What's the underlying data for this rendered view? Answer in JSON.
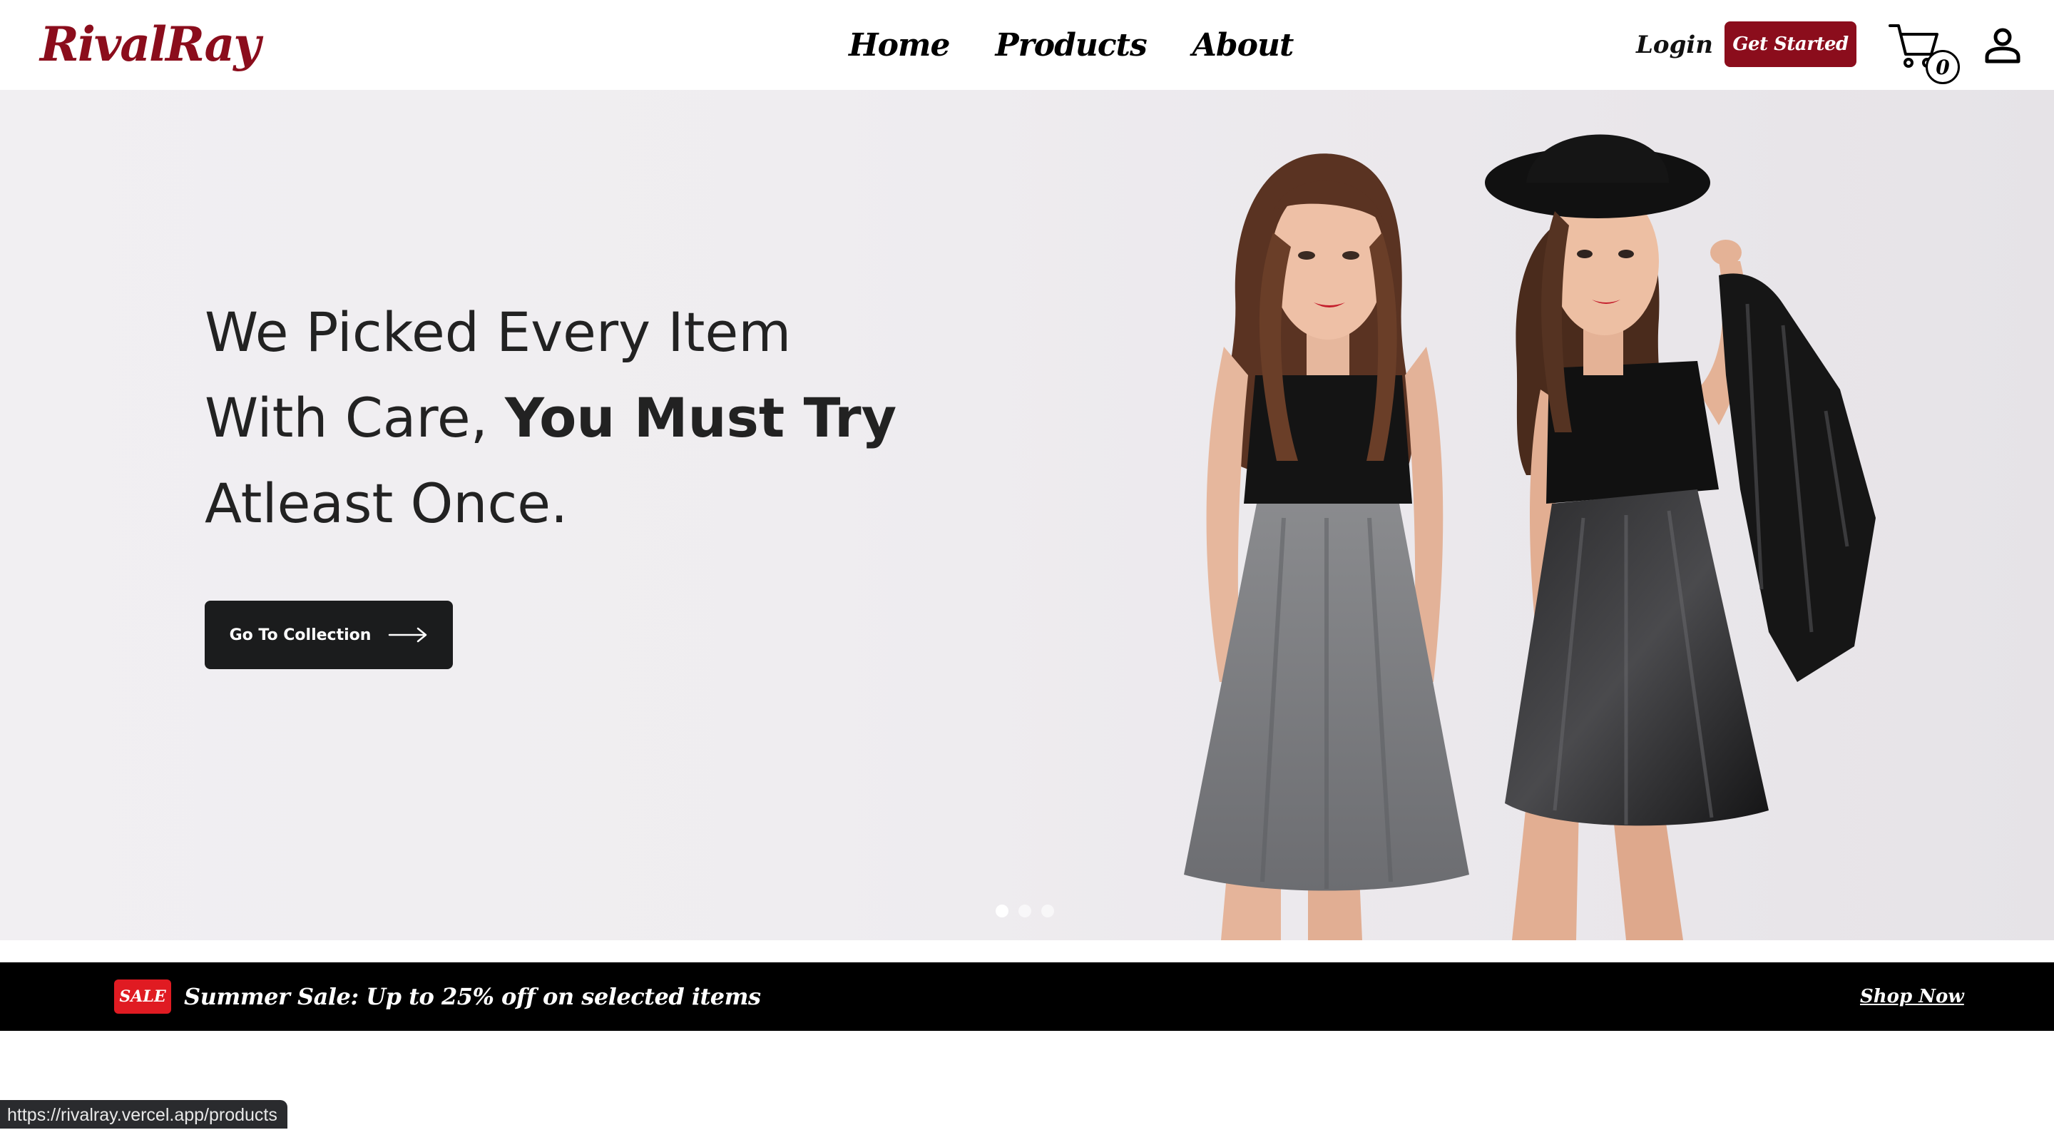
{
  "header": {
    "logo": "RivalRay",
    "nav": [
      {
        "label": "Home"
      },
      {
        "label": "Products"
      },
      {
        "label": "About"
      }
    ],
    "login_label": "Login",
    "get_started_label": "Get Started",
    "cart_count": "0",
    "icons": {
      "cart": "cart-icon",
      "profile": "user-icon"
    }
  },
  "hero": {
    "heading_line1": "We Picked Every Item",
    "heading_line2_regular": "With Care, ",
    "heading_line2_bold": "You Must Try",
    "heading_line3": "Atleast Once.",
    "cta_label": "Go To Collection",
    "cta_icon": "arrow-right-icon",
    "slide_count": 3,
    "active_slide": 1
  },
  "sale": {
    "badge": "SALE",
    "text": "Summer Sale: Up to 25% off on selected items",
    "link_label": "Shop Now"
  },
  "status_bar": {
    "url": "https://rivalray.vercel.app/products"
  },
  "colors": {
    "brand": "#8b0d1c",
    "sale_badge": "#e01b22",
    "cta_bg": "#1b1c1d",
    "banner_bg": "#000000"
  }
}
